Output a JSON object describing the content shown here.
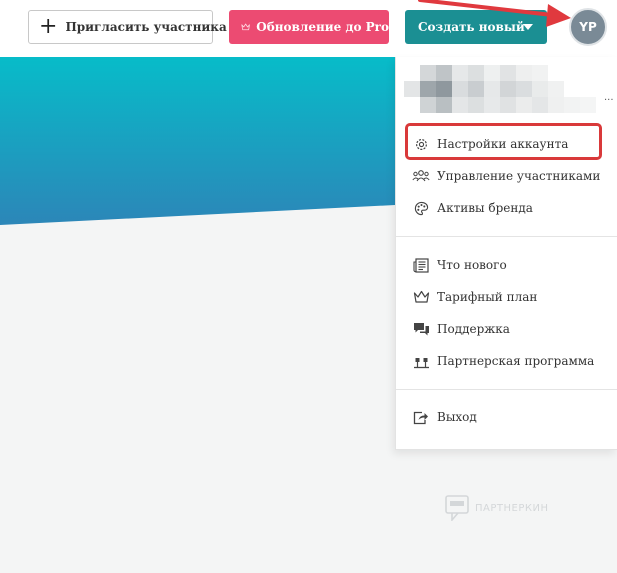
{
  "toolbar": {
    "invite_label": "Пригласить участника",
    "upgrade_label": "Обновление до Pro",
    "create_label": "Создать новый",
    "avatar_initials": "YP"
  },
  "colors": {
    "upgrade_bg": "#ec4b72",
    "create_bg": "#1b8f93",
    "hero_start": "#07bcc9",
    "hero_end": "#2c86b8",
    "highlight": "#d9393a",
    "arrow": "#e0393e"
  },
  "menu": {
    "ellipsis": "...",
    "items": [
      {
        "label": "Настройки аккаунта",
        "icon": "gear-icon"
      },
      {
        "label": "Управление участниками",
        "icon": "team-icon"
      },
      {
        "label": "Активы бренда",
        "icon": "palette-icon"
      },
      {
        "label": "Что нового",
        "icon": "newspaper-icon"
      },
      {
        "label": "Тарифный план",
        "icon": "crown-icon"
      },
      {
        "label": "Поддержка",
        "icon": "chat-icon"
      },
      {
        "label": "Партнерская программа",
        "icon": "affiliate-icon"
      },
      {
        "label": "Выход",
        "icon": "logout-icon"
      }
    ]
  },
  "watermark": {
    "text": "ПАРТНЕРКИН"
  }
}
